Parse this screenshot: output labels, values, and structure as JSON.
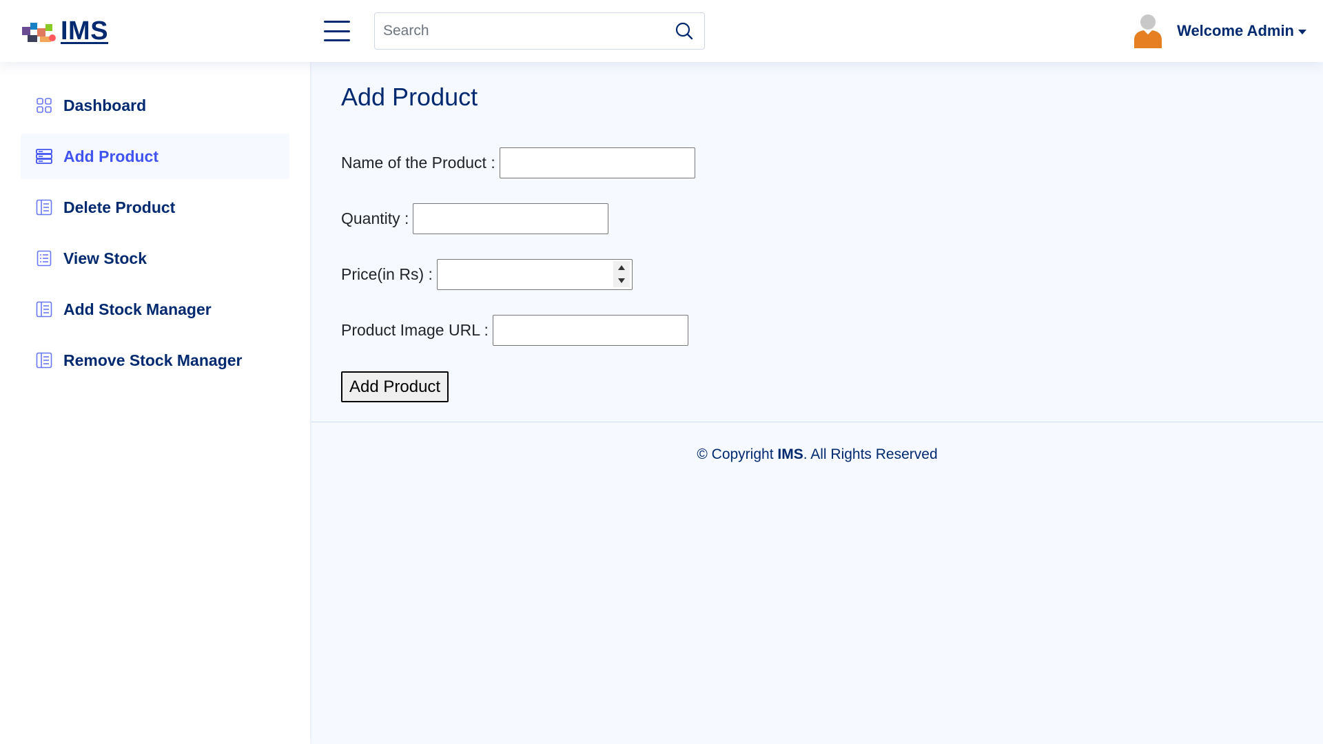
{
  "header": {
    "logo_text": "IMS",
    "search_placeholder": "Search",
    "welcome_text": "Welcome Admin"
  },
  "sidebar": {
    "items": [
      {
        "label": "Dashboard",
        "icon": "grid-icon",
        "active": false
      },
      {
        "label": "Add Product",
        "icon": "server-icon",
        "active": true
      },
      {
        "label": "Delete Product",
        "icon": "layout-text-sidebar-icon",
        "active": false
      },
      {
        "label": "View Stock",
        "icon": "card-list-icon",
        "active": false
      },
      {
        "label": "Add Stock Manager",
        "icon": "layout-text-sidebar-icon",
        "active": false
      },
      {
        "label": "Remove Stock Manager",
        "icon": "layout-text-sidebar-icon",
        "active": false
      }
    ]
  },
  "main": {
    "title": "Add Product",
    "form": {
      "name_label": "Name of the Product :",
      "name_value": "",
      "quantity_label": "Quantity :",
      "quantity_value": "",
      "price_label": "Price(in Rs) :",
      "price_value": "",
      "image_url_label": "Product Image URL :",
      "image_url_value": "",
      "submit_label": "Add Product"
    }
  },
  "footer": {
    "prefix": "© Copyright ",
    "brand": "IMS",
    "suffix": ". All Rights Reserved"
  },
  "colors": {
    "primary_text": "#012970",
    "accent": "#4154f1",
    "background": "#f6f9ff",
    "avatar": "#e67e22"
  }
}
